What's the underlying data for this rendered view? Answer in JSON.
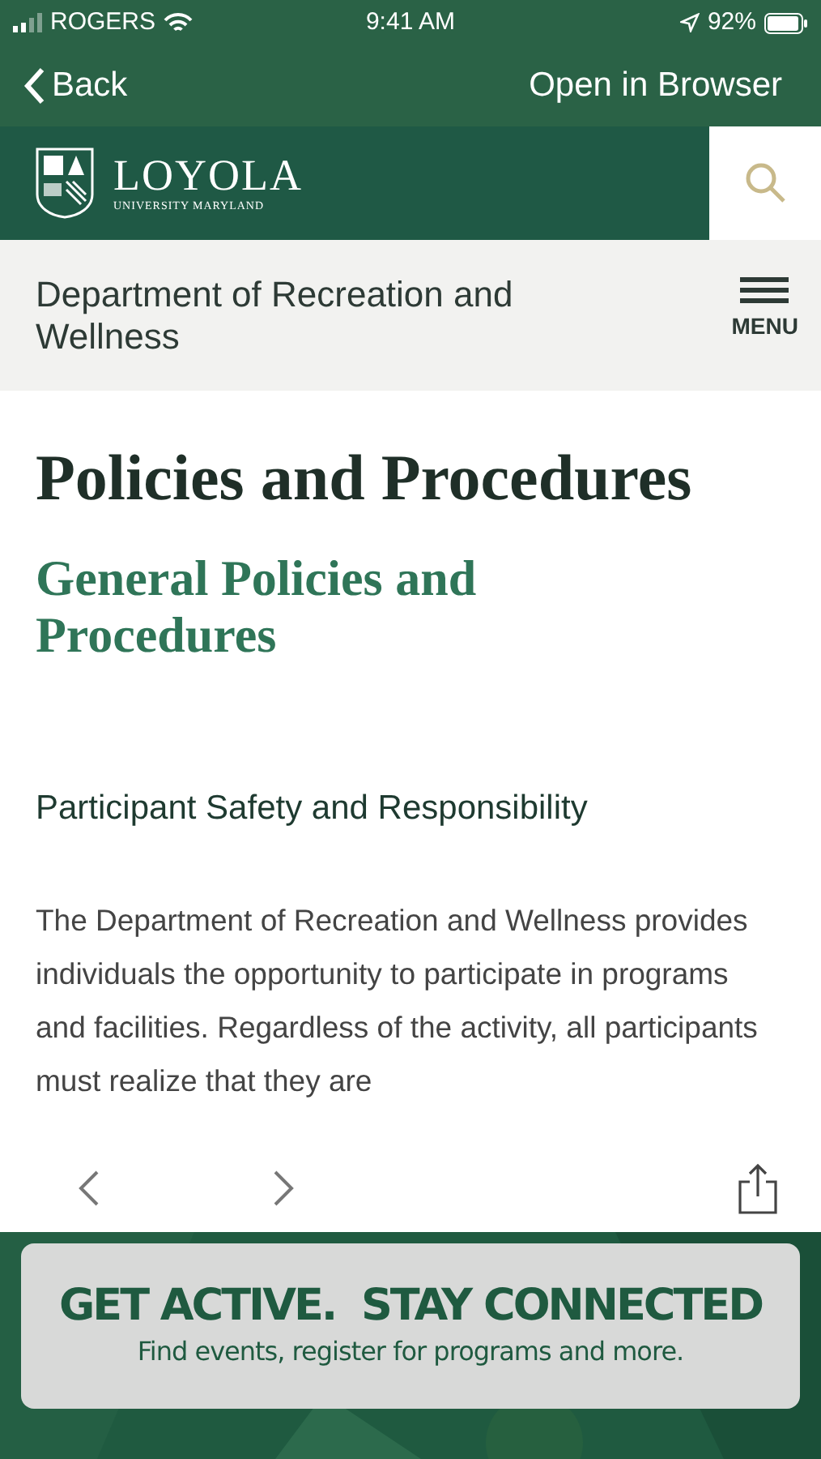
{
  "status_bar": {
    "carrier": "ROGERS",
    "time": "9:41 AM",
    "battery": "92%"
  },
  "nav": {
    "back": "Back",
    "action": "Open in Browser"
  },
  "site_header": {
    "logo_name": "LOYOLA",
    "logo_sub": "UNIVERSITY MARYLAND"
  },
  "section_bar": {
    "title": "Department of Recreation and Wellness",
    "menu": "MENU"
  },
  "content": {
    "title": "Policies and Procedures",
    "subtitle": "General Policies and Procedures",
    "heading": "Participant Safety and Responsibility",
    "paragraph": "The Department of Recreation and Wellness provides individuals the opportunity to participate in programs and facilities. Regardless of the activity, all participants must realize that they are"
  },
  "banner": {
    "headline": "GET ACTIVE.  STAY CONNECTED",
    "tagline": "Find events, register for programs and more."
  }
}
